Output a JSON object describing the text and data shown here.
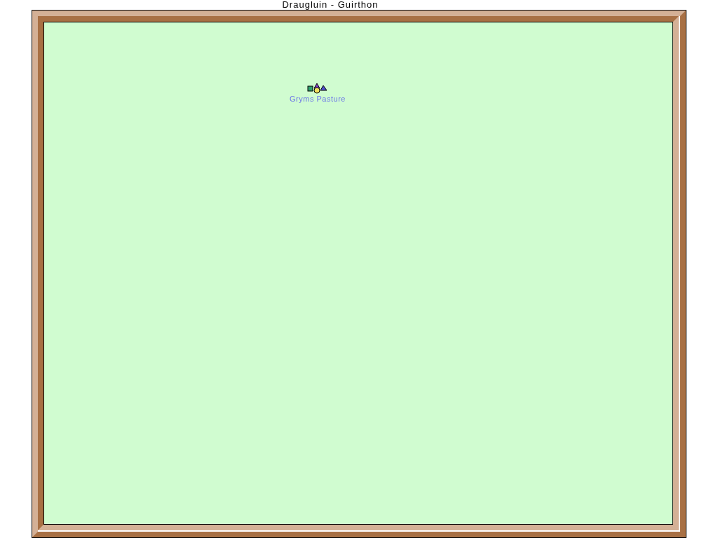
{
  "window": {
    "title": "Draugluin - Guirthon"
  },
  "map": {
    "locations": [
      {
        "name": "Gryms Pasture"
      }
    ]
  }
}
